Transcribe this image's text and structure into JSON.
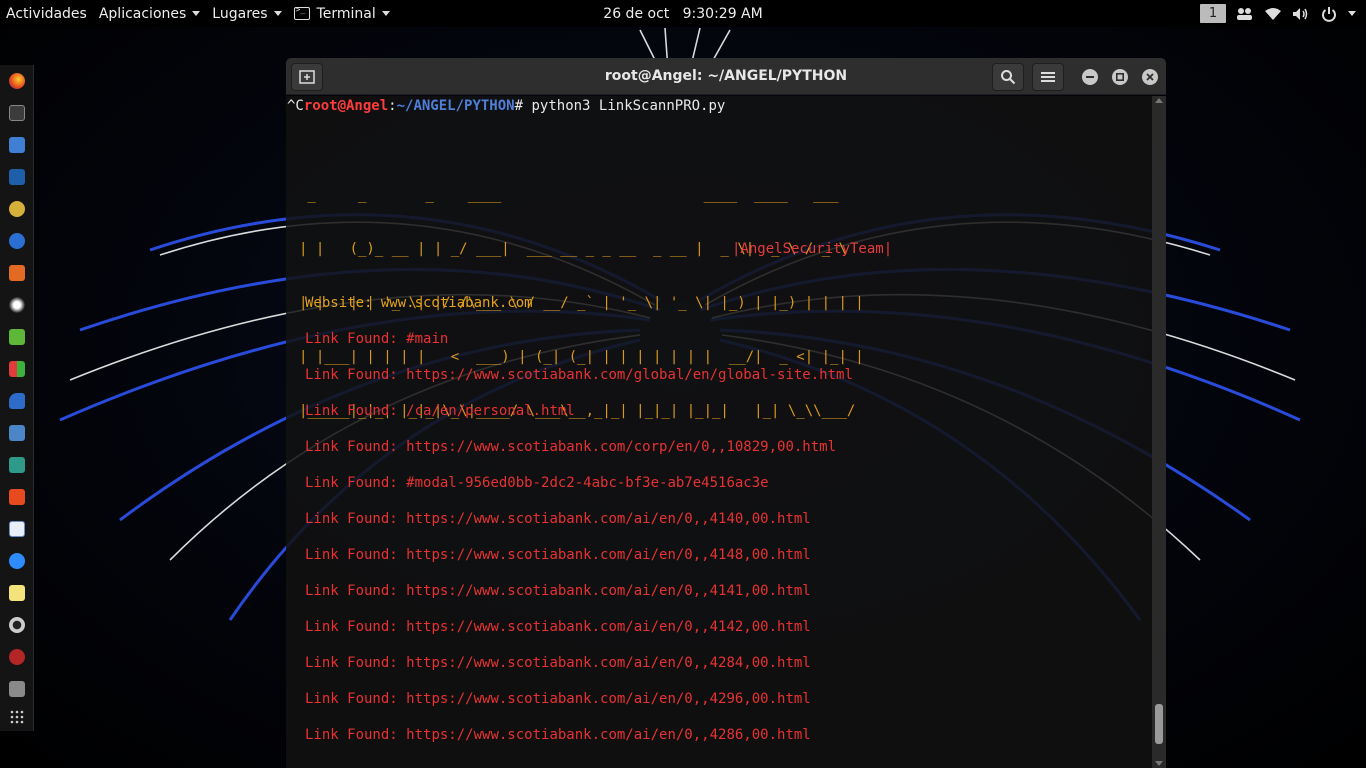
{
  "topbar": {
    "activities": "Actividades",
    "applications": "Aplicaciones",
    "places": "Lugares",
    "app": "Terminal",
    "date": "26 de oct",
    "time": "9:30:29 AM",
    "workspace": "1",
    "icons": [
      "people-icon",
      "wifi-icon",
      "volume-icon",
      "power-icon"
    ]
  },
  "dock": {
    "apps": [
      "firefox-icon",
      "terminal-icon",
      "files-icon",
      "metasploit-icon",
      "armitage-icon",
      "burp-icon",
      "maltego-icon",
      "zap-icon",
      "leafpad-icon",
      "faraday-icon",
      "wireshark-icon",
      "beef-icon",
      "cutycapt-icon",
      "ftp-icon",
      "text-editor-icon",
      "zoom-icon",
      "notes-icon",
      "tor-icon",
      "cherrytree-icon",
      "usb-icon",
      "show-apps-icon"
    ]
  },
  "window": {
    "title": "root@Angel: ~/ANGEL/PYTHON"
  },
  "terminal": {
    "prompt_prefix": "^C",
    "prompt_user": "root@Angel",
    "prompt_sep": ":",
    "prompt_path": "~/ANGEL/PYTHON",
    "prompt_end": "#",
    "command": " python3 LinkScannPRO.py",
    "banner": [
      " _     _       _    ____                        ____  ____   ___  ",
      "| |   (_)_ __ | | _/ ___|  ___ __ _ _ __  _ __ |  _ \\|  _ \\ / _ \\ ",
      "| |   | | '_ \\| |/ /\\___ \\ / __/ _` | '_ \\| '_ \\| |_) | |_) | | | |",
      "| |___| | | | |   <  ___) | (_| (_| | | | | | | |  __/|  _ <| |_| |",
      "|_____|_|_| |_|_|\\_\\|____/ \\___\\__,_|_| |_|_| |_|_|   |_| \\_\\\\___/ "
    ],
    "team": "|AngelSecurityTeam|",
    "website_label": "Website: www.scotiabank.com",
    "link_prefix": "Link Found: ",
    "links": [
      "#main",
      "https://www.scotiabank.com/global/en/global-site.html",
      "/ca/en/personal.html",
      "https://www.scotiabank.com/corp/en/0,,10829,00.html",
      "#modal-956ed0bb-2dc2-4abc-bf3e-ab7e4516ac3e",
      "https://www.scotiabank.com/ai/en/0,,4140,00.html",
      "https://www.scotiabank.com/ai/en/0,,4148,00.html",
      "https://www.scotiabank.com/ai/en/0,,4141,00.html",
      "https://www.scotiabank.com/ai/en/0,,4142,00.html",
      "https://www.scotiabank.com/ai/en/0,,4284,00.html",
      "https://www.scotiabank.com/ai/en/0,,4296,00.html",
      "https://www.scotiabank.com/ai/en/0,,4286,00.html"
    ]
  }
}
